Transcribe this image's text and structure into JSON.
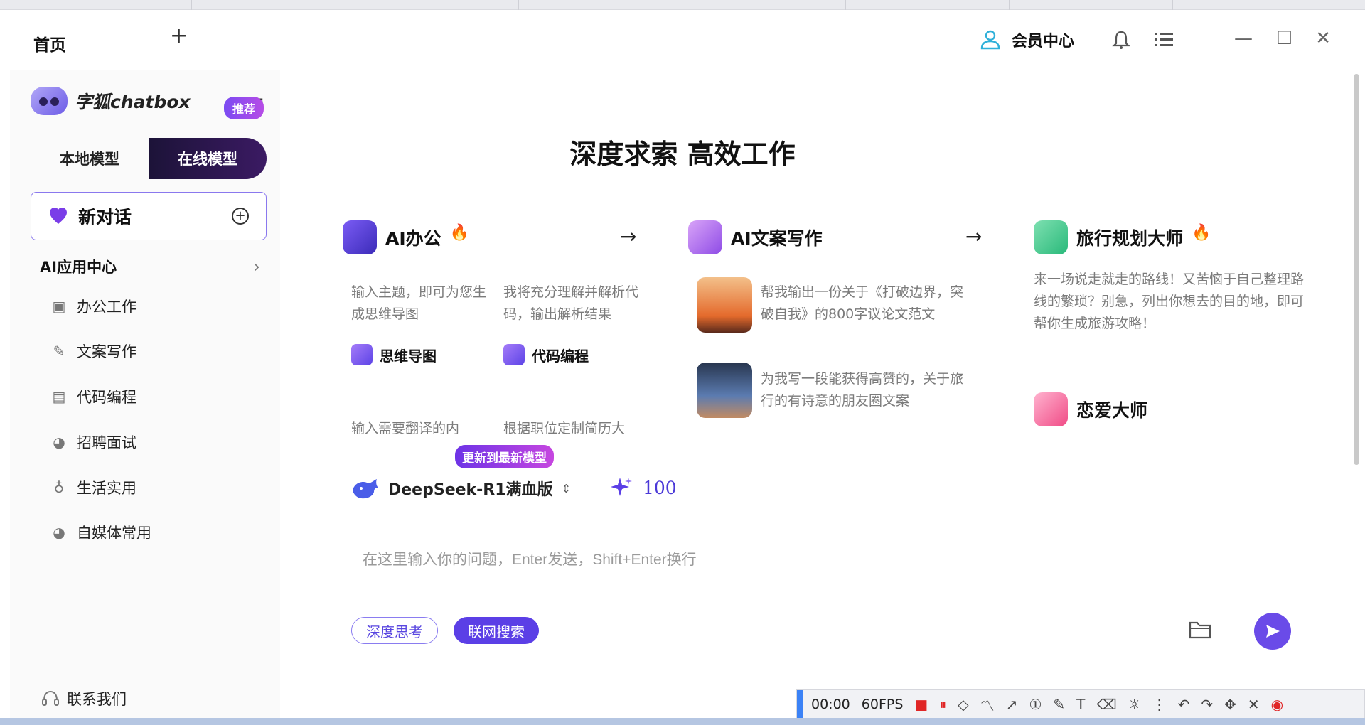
{
  "titlebar": {
    "home_tab": "首页",
    "new_tab": "+",
    "member_center": "会员中心",
    "minimize": "—",
    "maximize": "☐",
    "close": "✕"
  },
  "sidebar": {
    "brand": "字狐chatbox",
    "menu_toggle": "≡",
    "local_model": "本地模型",
    "online_model": "在线模型",
    "recommend_badge": "推荐",
    "new_chat": "新对话",
    "app_center": "AI应用中心",
    "nav": [
      {
        "label": "办公工作",
        "icon": "briefcase-icon"
      },
      {
        "label": "文案写作",
        "icon": "pen-icon"
      },
      {
        "label": "代码编程",
        "icon": "terminal-icon"
      },
      {
        "label": "招聘面试",
        "icon": "palette-icon"
      },
      {
        "label": "生活实用",
        "icon": "bulb-icon"
      },
      {
        "label": "自媒体常用",
        "icon": "palette-icon"
      }
    ],
    "contact": "联系我们"
  },
  "main": {
    "hero_title": "深度求索 高效工作",
    "cards": {
      "office": {
        "title": "AI办公",
        "desc1": "输入主题，即可为您生成思维导图",
        "desc2": "我将充分理解并解析代码，输出解析结果",
        "item1": "思维导图",
        "item2": "代码编程",
        "desc3": "输入需要翻译的内",
        "desc4": "根据职位定制简历大"
      },
      "copywriting": {
        "title": "AI文案写作",
        "prompt1": "帮我输出一份关于《打破边界，突破自我》的800字议论文范文",
        "prompt2": "为我写一段能获得高赞的，关于旅行的有诗意的朋友圈文案"
      },
      "travel": {
        "title": "旅行规划大师",
        "desc": "来一场说走就走的路线！又苦恼于自己整理路线的繁琐？别急，列出你想去的目的地，即可帮你生成旅游攻略！"
      },
      "love": {
        "title": "恋爱大师"
      }
    },
    "update_badge": "更新到最新模型",
    "model_name": "DeepSeek-R1满血版",
    "credits": "100",
    "input_placeholder": "在这里输入你的问题，Enter发送，Shift+Enter换行",
    "deep_think": "深度思考",
    "web_search": "联网搜索"
  },
  "recorder": {
    "time": "00:00",
    "fps": "60FPS"
  },
  "colors": {
    "accent": "#5b3fe6",
    "dark_tab": "#1c1338",
    "badge": "#7a4bf2"
  }
}
